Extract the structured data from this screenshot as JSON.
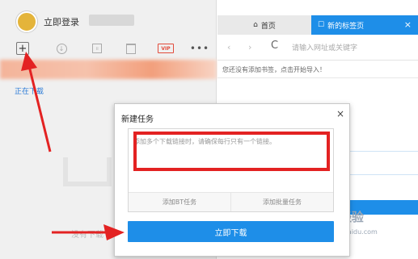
{
  "left": {
    "login_label": "立即登录",
    "toolbar": {
      "new_icon": "plus-icon",
      "download_icon": "download-icon",
      "pause_icon": "pause-icon",
      "delete_icon": "trash-icon",
      "vip_label": "VIP",
      "more_label": "•••"
    },
    "downloading_label": "正在下载",
    "empty_text": "没有下载"
  },
  "browser": {
    "tabs": [
      {
        "label": "首页",
        "icon": "home-icon"
      },
      {
        "label": "新的标签页",
        "icon": "page-icon"
      }
    ],
    "tab_close": "×",
    "nav_back": "‹",
    "nav_forward": "›",
    "nav_refresh": "C",
    "url_placeholder": "请输入网址或关键字",
    "bookmark_hint": "您还没有添加书签，点击开始导入！"
  },
  "dialog": {
    "title": "新建任务",
    "close": "×",
    "textarea_placeholder": "添加多个下载链接时，请确保每行只有一个链接。",
    "actions": [
      "添加BT任务",
      "添加批量任务"
    ],
    "download_button": "立即下载"
  },
  "watermark": {
    "main": "Bai 经验",
    "sub": "jingyan.baidu.com"
  },
  "colors": {
    "accent": "#1e8ee8",
    "annotation_red": "#e32222",
    "vip_red": "#e24b3b"
  }
}
